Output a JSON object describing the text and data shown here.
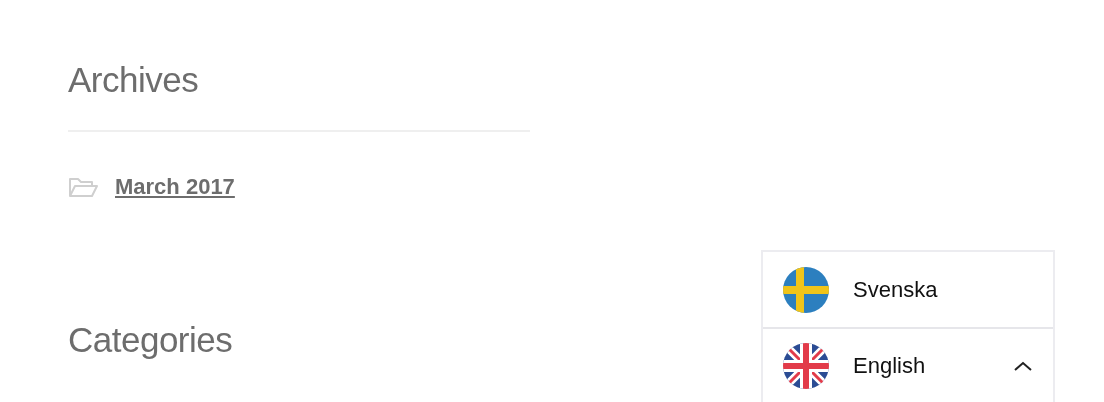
{
  "widgets": [
    {
      "title": "Archives",
      "links": [
        "March 2017"
      ]
    },
    {
      "title": "Categories"
    }
  ],
  "language_switcher": {
    "expanded": true,
    "languages": [
      {
        "label": "Svenska",
        "kind": "sweden",
        "selected": false
      },
      {
        "label": "English",
        "kind": "uk",
        "selected": true
      }
    ]
  }
}
